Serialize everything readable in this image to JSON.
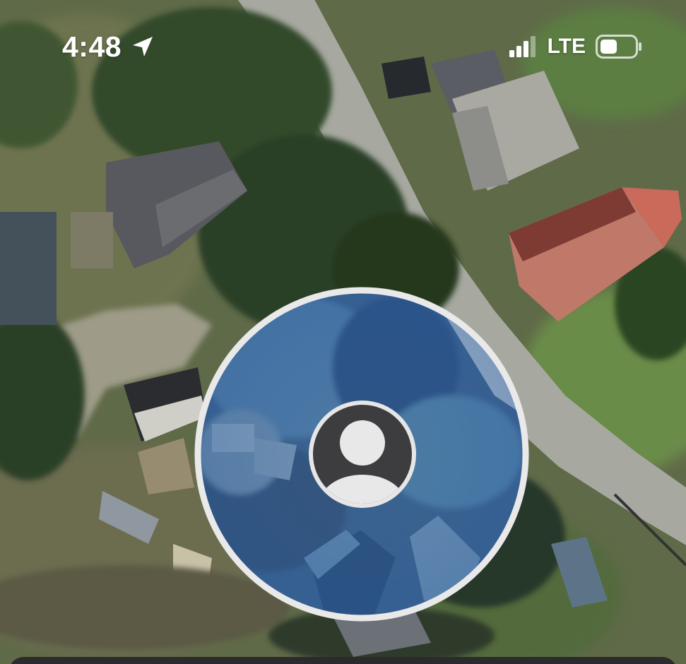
{
  "status_bar": {
    "time": "4:48",
    "network": "LTE",
    "location_icon": "location-arrow-icon",
    "signal_icon": "cellular-signal-icon",
    "battery_icon": "battery-icon",
    "signal_bars": 3,
    "battery_level": 0.3
  },
  "map": {
    "view": "satellite",
    "user_marker_icon": "person-icon"
  },
  "colors": {
    "status_text": "#ffffff",
    "avatar_bg": "#3d3d3f",
    "avatar_figure": "#e8e8e8",
    "marker_ring": "#e9e9e9",
    "sheet_bg": "#2b2b2d"
  }
}
